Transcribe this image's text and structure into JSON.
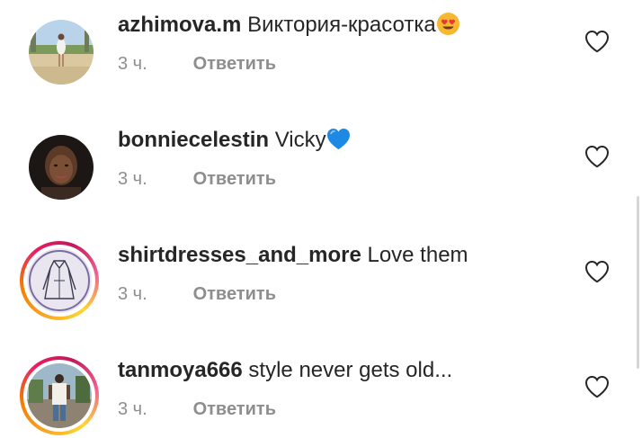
{
  "comments": [
    {
      "username": "azhimova.m",
      "text": "Виктория-красотка",
      "emoji": "smiling-face-with-heart-eyes",
      "time": "3 ч.",
      "reply_label": "Ответить",
      "has_story_ring": false
    },
    {
      "username": "bonniecelestin",
      "text": "Vicky",
      "emoji": "blue-heart",
      "time": "3 ч.",
      "reply_label": "Ответить",
      "has_story_ring": false
    },
    {
      "username": "shirtdresses_and_more",
      "text": "Love them",
      "emoji": "",
      "time": "3 ч.",
      "reply_label": "Ответить",
      "has_story_ring": true
    },
    {
      "username": "tanmoya666",
      "text": "style never gets old...",
      "emoji": "",
      "time": "3 ч.",
      "reply_label": "Ответить",
      "has_story_ring": true
    }
  ],
  "colors": {
    "text": "#262626",
    "secondary": "#8e8e8e",
    "heart_blue": "#1e88e5",
    "emoji_yellow": "#f7b731",
    "story_ring": [
      "#f9a825",
      "#e91e63"
    ]
  },
  "icons": {
    "like": "heart-outline-icon"
  }
}
